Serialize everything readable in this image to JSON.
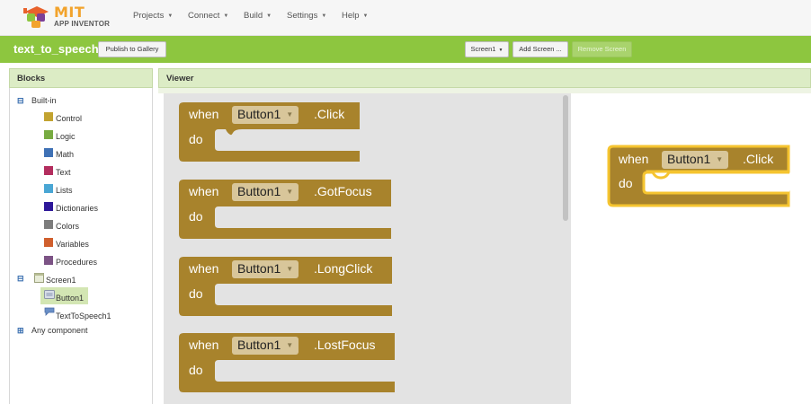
{
  "logo": {
    "mit": "MIT",
    "app_inventor": "APP INVENTOR"
  },
  "nav": {
    "projects": "Projects",
    "connect": "Connect",
    "build": "Build",
    "settings": "Settings",
    "help": "Help"
  },
  "project": {
    "name": "text_to_speech",
    "publish_label": "Publish to Gallery",
    "screen_select": "Screen1",
    "add_screen_label": "Add Screen ...",
    "remove_screen_label": "Remove Screen"
  },
  "blocks_panel": {
    "title": "Blocks",
    "built_in": "Built-in",
    "categories": [
      {
        "label": "Control",
        "color": "#c2a330"
      },
      {
        "label": "Logic",
        "color": "#77ab41"
      },
      {
        "label": "Math",
        "color": "#3f71b5"
      },
      {
        "label": "Text",
        "color": "#b32d5e"
      },
      {
        "label": "Lists",
        "color": "#49a6d4"
      },
      {
        "label": "Dictionaries",
        "color": "#2d1799"
      },
      {
        "label": "Colors",
        "color": "#7d7d7d"
      },
      {
        "label": "Variables",
        "color": "#d05f2d"
      },
      {
        "label": "Procedures",
        "color": "#7c5385"
      }
    ],
    "screen": "Screen1",
    "components": [
      "Button1",
      "TextToSpeech1"
    ],
    "any_component": "Any component"
  },
  "viewer": {
    "title": "Viewer",
    "block_color": "#a8832c",
    "flyout_blocks": [
      {
        "when": "when",
        "component": "Button1",
        "event": ".Click",
        "do": "do"
      },
      {
        "when": "when",
        "component": "Button1",
        "event": ".GotFocus",
        "do": "do"
      },
      {
        "when": "when",
        "component": "Button1",
        "event": ".LongClick",
        "do": "do"
      },
      {
        "when": "when",
        "component": "Button1",
        "event": ".LostFocus",
        "do": "do"
      }
    ],
    "workspace_block": {
      "when": "when",
      "component": "Button1",
      "event": ".Click",
      "do": "do",
      "highlight": "#f5c430"
    }
  }
}
